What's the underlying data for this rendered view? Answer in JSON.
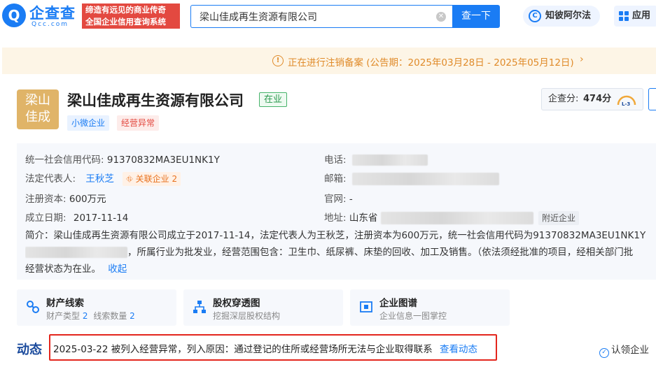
{
  "header": {
    "logo_text": "企查查",
    "logo_sub": "Qcc.com",
    "slogan_line1": "缔造有远见的商业传奇",
    "slogan_line2": "全国企业信用查询系统",
    "search_value": "梁山佳成再生资源有限公司",
    "search_button": "查一下",
    "assistant_label": "知彼阿尔法",
    "apps_label": "应用"
  },
  "notice": {
    "text": "正在进行注销备案 (公告期：2025年03月28日 - 2025年05月12日)"
  },
  "company": {
    "logo_line1": "梁山",
    "logo_line2": "佳成",
    "name": "梁山佳成再生资源有限公司",
    "status": "在业",
    "tags": [
      "小微企业",
      "经营异常"
    ],
    "score_label": "企查分:",
    "score_value": "474分",
    "score_level": "L-3"
  },
  "info": {
    "credit_code_label": "统一社会信用代码:",
    "credit_code": "91370832MA3EU1NK1Y",
    "legal_rep_label": "法定代表人:",
    "legal_rep": "王秋芝",
    "related_label": "关联企业",
    "related_count": "2",
    "capital_label": "注册资本:",
    "capital": "600万元",
    "founded_label": "成立日期:",
    "founded": "2017-11-14",
    "phone_label": "电话:",
    "email_label": "邮箱:",
    "website_label": "官网:",
    "website": "-",
    "address_label": "地址:",
    "address_prefix": "山东省",
    "nearby_label": "附近企业",
    "intro_line1": "简介：梁山佳成再生资源有限公司成立于2017-11-14，法定代表人为王秋芝，注册资本为600万元，统一社会信用代码为91370832MA3EU1NK1Y",
    "intro_line2": "，所属行业为批发业，经营范围包含：卫生巾、纸尿裤、床垫的回收、加工及销售。（依法须经批准的项目，经相关部门批",
    "intro_line3": "经营状态为在业。",
    "collapse_label": "收起"
  },
  "features": [
    {
      "title": "财产线索",
      "sub1_label": "财产类型",
      "sub1_num": "2",
      "sub2_label": "线索数量",
      "sub2_num": "2"
    },
    {
      "title": "股权穿透图",
      "sub": "挖掘深层股权结构"
    },
    {
      "title": "企业图谱",
      "sub": "企业信息一图掌控"
    }
  ],
  "dynamics": {
    "title": "动态",
    "text": "2025-03-22 被列入经营异常，列入原因：通过登记的住所或经营场所无法与企业取得联系",
    "link": "查看动态",
    "claim": "认领企业"
  }
}
